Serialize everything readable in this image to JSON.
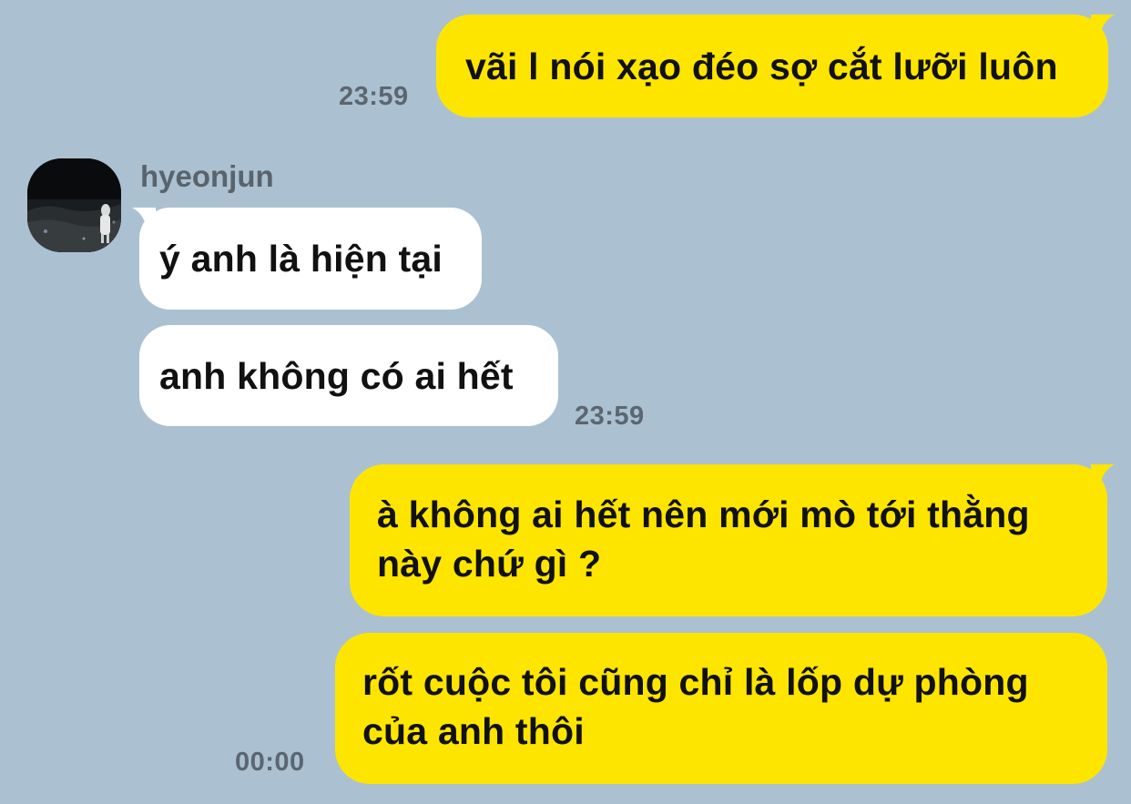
{
  "chat": {
    "messages": [
      {
        "from": "me",
        "text": "vãi l nói xạo đéo sợ cắt lưỡi luôn",
        "time": "23:59"
      },
      {
        "from": "them",
        "sender": "hyeonjun",
        "text": "ý anh là hiện tại"
      },
      {
        "from": "them",
        "text": "anh không có ai hết",
        "time": "23:59"
      },
      {
        "from": "me",
        "lines": [
          "à không ai hết nên mới mò tới thằng",
          "này chứ gì ?"
        ]
      },
      {
        "from": "me",
        "lines": [
          "rốt cuộc tôi cũng chỉ là lốp dự phòng",
          "của anh thôi"
        ],
        "time": "00:00"
      }
    ],
    "avatar_icon": "profile-photo-person-at-night",
    "colors": {
      "background": "#abc1d1",
      "my_bubble": "#fee500",
      "their_bubble": "#ffffff",
      "timestamp": "#5b6670",
      "sender_name": "#59636c"
    }
  }
}
